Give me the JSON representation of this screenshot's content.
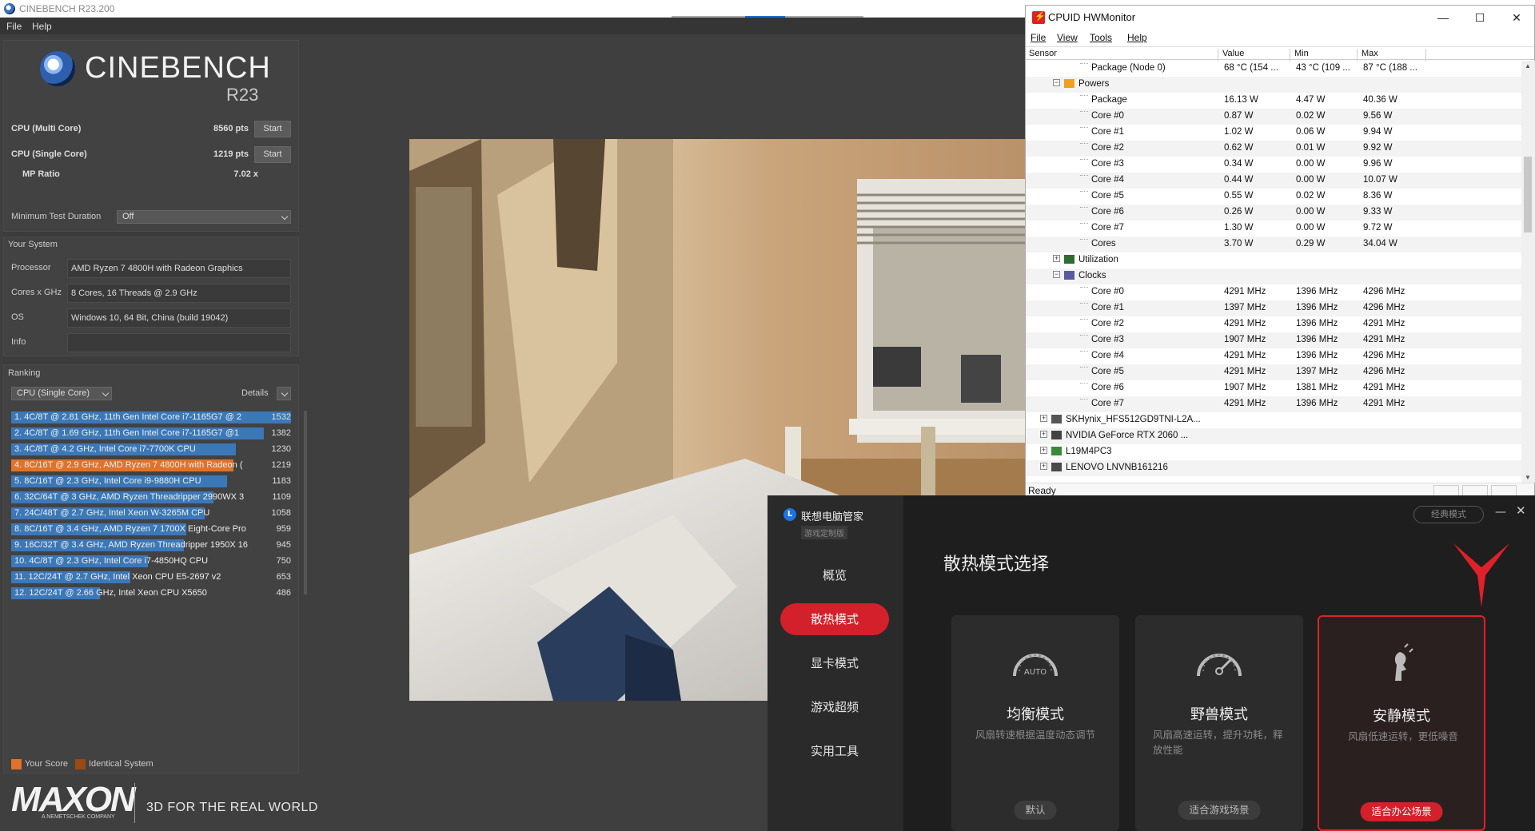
{
  "cinebench": {
    "window_title": "CINEBENCH R23.200",
    "menu": [
      "File",
      "Help"
    ],
    "brand": "CINEBENCH",
    "brand_version": "R23",
    "multi_label": "CPU (Multi Core)",
    "multi_score": "8560 pts",
    "single_label": "CPU (Single Core)",
    "single_score": "1219 pts",
    "start_label": "Start",
    "mp_label": "MP Ratio",
    "mp_value": "7.02 x",
    "min_test_label": "Minimum Test Duration",
    "min_test_value": "Off",
    "your_system_label": "Your System",
    "system": [
      {
        "label": "Processor",
        "value": "AMD Ryzen 7 4800H with Radeon Graphics"
      },
      {
        "label": "Cores x GHz",
        "value": "8 Cores, 16 Threads @ 2.9 GHz"
      },
      {
        "label": "OS",
        "value": "Windows 10, 64 Bit, China (build 19042)"
      },
      {
        "label": "Info",
        "value": ""
      }
    ],
    "ranking_label": "Ranking",
    "ranking_select": "CPU (Single Core)",
    "details_label": "Details",
    "ranking": [
      {
        "text": "1. 4C/8T @ 2.81 GHz, 11th Gen Intel Core i7-1165G7 @ 2",
        "score": 1532,
        "me": false
      },
      {
        "text": "2. 4C/8T @ 1.69 GHz, 11th Gen Intel Core i7-1165G7 @1",
        "score": 1382,
        "me": false
      },
      {
        "text": "3. 4C/8T @ 4.2 GHz, Intel Core i7-7700K CPU",
        "score": 1230,
        "me": false
      },
      {
        "text": "4. 8C/16T @ 2.9 GHz, AMD Ryzen 7 4800H with Radeon (",
        "score": 1219,
        "me": true
      },
      {
        "text": "5. 8C/16T @ 2.3 GHz, Intel Core i9-9880H CPU",
        "score": 1183,
        "me": false
      },
      {
        "text": "6. 32C/64T @ 3 GHz, AMD Ryzen Threadripper 2990WX 3",
        "score": 1109,
        "me": false
      },
      {
        "text": "7. 24C/48T @ 2.7 GHz, Intel Xeon W-3265M CPU",
        "score": 1058,
        "me": false
      },
      {
        "text": "8. 8C/16T @ 3.4 GHz, AMD Ryzen 7 1700X Eight-Core Pro",
        "score": 959,
        "me": false
      },
      {
        "text": "9. 16C/32T @ 3.4 GHz, AMD Ryzen Threadripper 1950X 16",
        "score": 945,
        "me": false
      },
      {
        "text": "10. 4C/8T @ 2.3 GHz, Intel Core i7-4850HQ CPU",
        "score": 750,
        "me": false
      },
      {
        "text": "11. 12C/24T @ 2.7 GHz, Intel Xeon CPU E5-2697 v2",
        "score": 653,
        "me": false
      },
      {
        "text": "12. 12C/24T @ 2.66 GHz, Intel Xeon CPU X5650",
        "score": 486,
        "me": false
      }
    ],
    "legend_your_score": "Your Score",
    "legend_identical": "Identical System",
    "colors": {
      "your_score": "#e0722a",
      "identical": "#9a4a14",
      "bar": "#3b78b8"
    },
    "maxon_logo": "MAXON",
    "maxon_sub": "A NEMETSCHEK COMPANY",
    "maxon_tagline": "3D FOR THE REAL WORLD"
  },
  "hwmonitor": {
    "title": "CPUID HWMonitor",
    "menu": [
      "File",
      "View",
      "Tools",
      "Help"
    ],
    "columns": [
      "Sensor",
      "Value",
      "Min",
      "Max"
    ],
    "rows": [
      {
        "indent": 3,
        "name": "Package (Node 0)",
        "value": "68 °C  (154 ...",
        "min": "43 °C  (109 ...",
        "max": "87 °C  (188 ..."
      },
      {
        "indent": 2,
        "group": true,
        "expanded": true,
        "icon": "power",
        "name": "Powers"
      },
      {
        "indent": 3,
        "name": "Package",
        "value": "16.13 W",
        "min": "4.47 W",
        "max": "40.36 W"
      },
      {
        "indent": 3,
        "name": "Core #0",
        "value": "0.87 W",
        "min": "0.02 W",
        "max": "9.56 W"
      },
      {
        "indent": 3,
        "name": "Core #1",
        "value": "1.02 W",
        "min": "0.06 W",
        "max": "9.94 W"
      },
      {
        "indent": 3,
        "name": "Core #2",
        "value": "0.62 W",
        "min": "0.01 W",
        "max": "9.92 W"
      },
      {
        "indent": 3,
        "name": "Core #3",
        "value": "0.34 W",
        "min": "0.00 W",
        "max": "9.96 W"
      },
      {
        "indent": 3,
        "name": "Core #4",
        "value": "0.44 W",
        "min": "0.00 W",
        "max": "10.07 W"
      },
      {
        "indent": 3,
        "name": "Core #5",
        "value": "0.55 W",
        "min": "0.02 W",
        "max": "8.36 W"
      },
      {
        "indent": 3,
        "name": "Core #6",
        "value": "0.26 W",
        "min": "0.00 W",
        "max": "9.33 W"
      },
      {
        "indent": 3,
        "name": "Core #7",
        "value": "1.30 W",
        "min": "0.00 W",
        "max": "9.72 W"
      },
      {
        "indent": 3,
        "name": "Cores",
        "value": "3.70 W",
        "min": "0.29 W",
        "max": "34.04 W"
      },
      {
        "indent": 2,
        "group": true,
        "expanded": false,
        "icon": "utilization",
        "name": "Utilization"
      },
      {
        "indent": 2,
        "group": true,
        "expanded": true,
        "icon": "clocks",
        "name": "Clocks"
      },
      {
        "indent": 3,
        "name": "Core #0",
        "value": "4291 MHz",
        "min": "1396 MHz",
        "max": "4296 MHz"
      },
      {
        "indent": 3,
        "name": "Core #1",
        "value": "1397 MHz",
        "min": "1396 MHz",
        "max": "4296 MHz"
      },
      {
        "indent": 3,
        "name": "Core #2",
        "value": "4291 MHz",
        "min": "1396 MHz",
        "max": "4291 MHz"
      },
      {
        "indent": 3,
        "name": "Core #3",
        "value": "1907 MHz",
        "min": "1396 MHz",
        "max": "4291 MHz"
      },
      {
        "indent": 3,
        "name": "Core #4",
        "value": "4291 MHz",
        "min": "1396 MHz",
        "max": "4296 MHz"
      },
      {
        "indent": 3,
        "name": "Core #5",
        "value": "4291 MHz",
        "min": "1397 MHz",
        "max": "4296 MHz"
      },
      {
        "indent": 3,
        "name": "Core #6",
        "value": "1907 MHz",
        "min": "1381 MHz",
        "max": "4291 MHz"
      },
      {
        "indent": 3,
        "name": "Core #7",
        "value": "4291 MHz",
        "min": "1396 MHz",
        "max": "4291 MHz"
      },
      {
        "indent": 1,
        "group": true,
        "expanded": false,
        "icon": "drive",
        "name": "SKHynix_HFS512GD9TNI-L2A..."
      },
      {
        "indent": 1,
        "group": true,
        "expanded": false,
        "icon": "gpu",
        "name": "NVIDIA GeForce RTX 2060 ..."
      },
      {
        "indent": 1,
        "group": true,
        "expanded": false,
        "icon": "battery",
        "name": "L19M4PC3"
      },
      {
        "indent": 1,
        "group": true,
        "expanded": false,
        "icon": "board",
        "name": "LENOVO LNVNB161216"
      }
    ],
    "status": "Ready"
  },
  "lenovo": {
    "app_name": "联想电脑管家",
    "app_sub": "游戏定制版",
    "nav": [
      "概览",
      "散热模式",
      "显卡模式",
      "游戏超频",
      "实用工具"
    ],
    "active_nav": 1,
    "classic_mode": "经典模式",
    "title": "散热模式选择",
    "accent": "#d4202a",
    "modes": [
      {
        "name": "均衡模式",
        "desc": "风扇转速根据温度动态调节",
        "tag": "默认",
        "icon_text": "AUTO",
        "selected": false
      },
      {
        "name": "野兽模式",
        "desc": "风扇高速运转，提升功耗，释放性能",
        "tag": "适合游戏场景",
        "selected": false
      },
      {
        "name": "安静模式",
        "desc": "风扇低速运转，更低噪音",
        "tag": "适合办公场景",
        "selected": true
      }
    ]
  }
}
